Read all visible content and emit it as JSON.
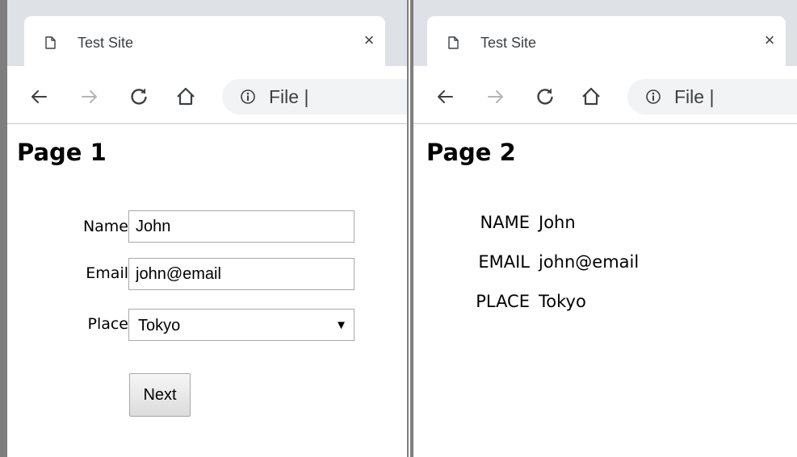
{
  "windows": [
    {
      "tab": {
        "title": "Test Site",
        "close": "×"
      },
      "address": {
        "prefix": "File",
        "caret": "|"
      },
      "page": {
        "title": "Page 1",
        "form": {
          "name_label": "Name",
          "name_value": "John",
          "email_label": "Email",
          "email_value": "john@email",
          "place_label": "Place",
          "place_value": "Tokyo",
          "next_label": "Next"
        }
      }
    },
    {
      "tab": {
        "title": "Test Site",
        "close": "×"
      },
      "address": {
        "prefix": "File",
        "caret": "|"
      },
      "page": {
        "title": "Page 2",
        "rows": [
          {
            "label": "NAME",
            "value": "John"
          },
          {
            "label": "EMAIL",
            "value": "john@email"
          },
          {
            "label": "PLACE",
            "value": "Tokyo"
          }
        ]
      }
    }
  ],
  "icons": {
    "back": "arrow-left-icon",
    "forward": "arrow-right-icon",
    "reload": "reload-icon",
    "home": "home-icon",
    "info": "info-icon",
    "favicon": "page-icon",
    "dropdown": "triangle-down-icon"
  },
  "colors": {
    "tabstrip": "#dee1e6",
    "omnibox": "#f1f3f4",
    "icon_active": "#3c4043",
    "icon_disabled": "#b5b5b5",
    "frame": "#7e7e7e"
  }
}
